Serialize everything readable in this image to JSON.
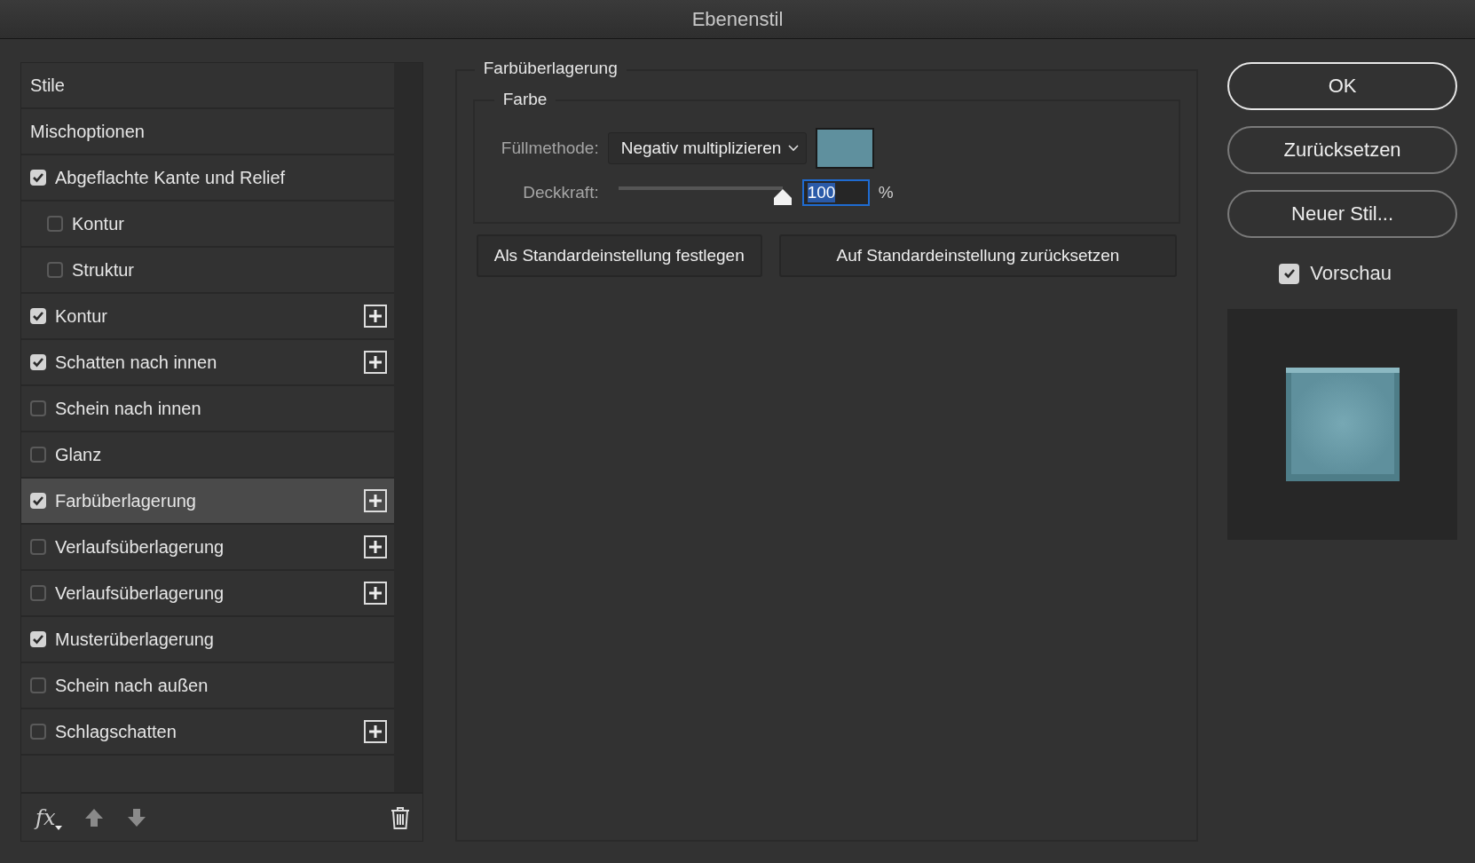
{
  "window": {
    "title": "Ebenenstil"
  },
  "styles": {
    "items": [
      {
        "kind": "header",
        "label": "Stile",
        "selected": false
      },
      {
        "kind": "header",
        "label": "Mischoptionen",
        "selected": false
      },
      {
        "kind": "effect",
        "label": "Abgeflachte Kante und Relief",
        "checked": true,
        "addable": false,
        "selected": false,
        "children": [
          {
            "kind": "effect",
            "label": "Kontur",
            "checked": false,
            "addable": false,
            "selected": false
          },
          {
            "kind": "effect",
            "label": "Struktur",
            "checked": false,
            "addable": false,
            "selected": false
          }
        ]
      },
      {
        "kind": "effect",
        "label": "Kontur",
        "checked": true,
        "addable": true,
        "selected": false
      },
      {
        "kind": "effect",
        "label": "Schatten nach innen",
        "checked": true,
        "addable": true,
        "selected": false
      },
      {
        "kind": "effect",
        "label": "Schein nach innen",
        "checked": false,
        "addable": false,
        "selected": false
      },
      {
        "kind": "effect",
        "label": "Glanz",
        "checked": false,
        "addable": false,
        "selected": false
      },
      {
        "kind": "effect",
        "label": "Farbüberlagerung",
        "checked": true,
        "addable": true,
        "selected": true
      },
      {
        "kind": "effect",
        "label": "Verlaufsüberlagerung",
        "checked": false,
        "addable": true,
        "selected": false
      },
      {
        "kind": "effect",
        "label": "Verlaufsüberlagerung",
        "checked": false,
        "addable": true,
        "selected": false
      },
      {
        "kind": "effect",
        "label": "Musterüberlagerung",
        "checked": true,
        "addable": false,
        "selected": false
      },
      {
        "kind": "effect",
        "label": "Schein nach außen",
        "checked": false,
        "addable": false,
        "selected": false
      },
      {
        "kind": "effect",
        "label": "Schlagschatten",
        "checked": false,
        "addable": true,
        "selected": false
      }
    ],
    "footer": {
      "fx_label": "fx"
    }
  },
  "panel": {
    "title": "Farbüberlagerung",
    "group": {
      "title": "Farbe",
      "blend_mode": {
        "label": "Füllmethode:",
        "value": "Negativ multiplizieren"
      },
      "swatch": {
        "color": "#5f909e"
      },
      "opacity": {
        "label": "Deckkraft:",
        "level": 1,
        "value": "100",
        "unit": "%"
      }
    },
    "buttons": [
      "Als Standardeinstellung festlegen",
      "Auf Standardeinstellung zurücksetzen"
    ]
  },
  "actions": [
    {
      "label": "OK",
      "default": true
    },
    {
      "label": "Zurücksetzen",
      "default": false
    },
    {
      "label": "Neuer Stil...",
      "default": false
    }
  ],
  "preview": {
    "label": "Vorschau",
    "checked": true
  }
}
